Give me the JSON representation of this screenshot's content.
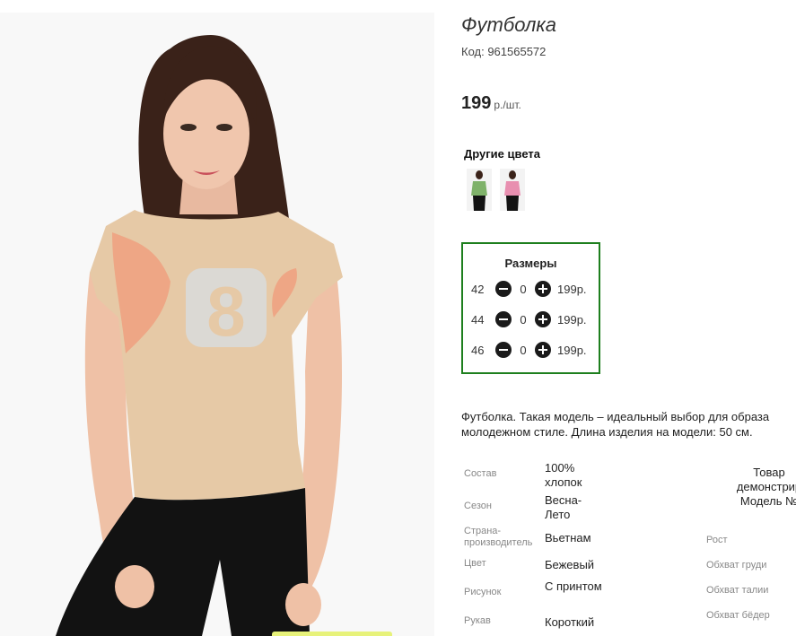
{
  "product": {
    "title": "Футболка",
    "code": "Код: 961565572",
    "price": "199",
    "price_unit": "р./шт."
  },
  "colors": {
    "title": "Другие цвета",
    "swatches": [
      {
        "name": "green",
        "color": "#7fb26a"
      },
      {
        "name": "pink",
        "color": "#e88fb0"
      }
    ]
  },
  "sizes": {
    "title": "Размеры",
    "rows": [
      {
        "size": "42",
        "qty": "0",
        "price": "199р."
      },
      {
        "size": "44",
        "qty": "0",
        "price": "199р."
      },
      {
        "size": "46",
        "qty": "0",
        "price": "199р."
      }
    ],
    "accent": "#1e7f1e"
  },
  "description": {
    "line1": "Футболка. Такая модель – идеальный выбор для образа",
    "line2": "молодежном стиле. Длина изделия на модели: 50 см."
  },
  "characteristics": [
    {
      "label": "Состав",
      "value": "100% хлопок"
    },
    {
      "label": "Сезон",
      "value": "Весна-Лето"
    },
    {
      "label": "Страна-производитель",
      "value": "Вьетнам"
    },
    {
      "label": "Цвет",
      "value": "Бежевый"
    },
    {
      "label": "Рисунок",
      "value": "С принтом"
    },
    {
      "label": "Рукав",
      "value": "Короткий"
    }
  ],
  "model": {
    "line1": "Товар",
    "line2": "демонстрир",
    "line3": "Модель №",
    "params": [
      "Рост",
      "Обхват груди",
      "Обхват талии",
      "Обхват бёдер"
    ]
  },
  "photo": {
    "shirt_color": "#e6c9a6",
    "pants_color": "#121212",
    "print_number": "8"
  }
}
